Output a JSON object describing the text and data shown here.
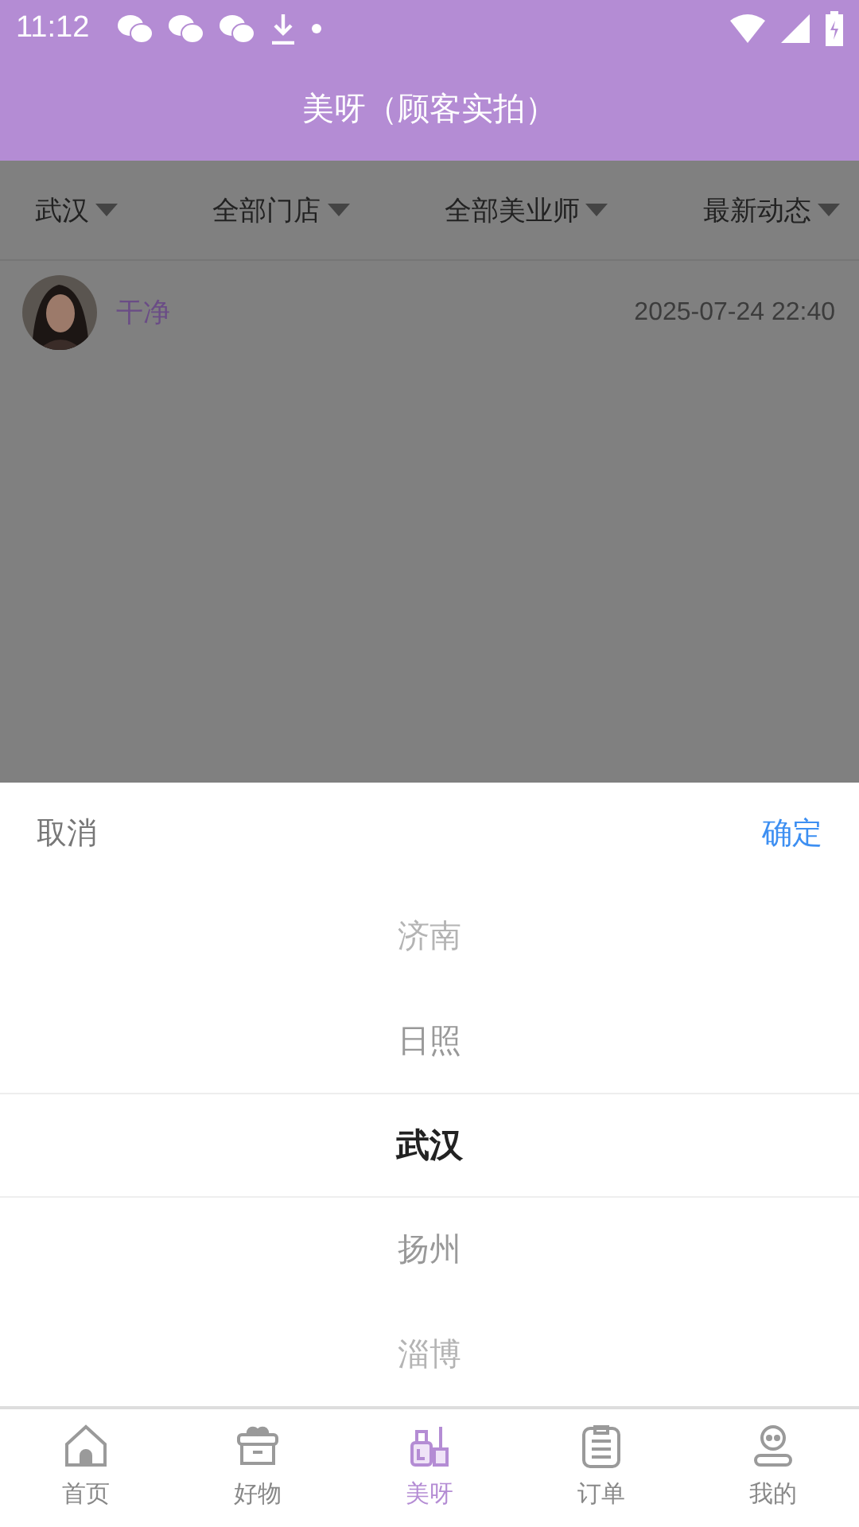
{
  "status_bar": {
    "time": "11:12"
  },
  "header": {
    "title": "美呀（顾客实拍）"
  },
  "filters": [
    {
      "label": "武汉"
    },
    {
      "label": "全部门店"
    },
    {
      "label": "全部美业师"
    },
    {
      "label": "最新动态"
    }
  ],
  "posts": [
    {
      "name": "干净",
      "time": "2025-07-24 22:40"
    }
  ],
  "picker": {
    "cancel": "取消",
    "confirm": "确定",
    "options": [
      {
        "label": "济南",
        "selected": false
      },
      {
        "label": "日照",
        "selected": false
      },
      {
        "label": "武汉",
        "selected": true
      },
      {
        "label": "扬州",
        "selected": false
      },
      {
        "label": "淄博",
        "selected": false
      }
    ]
  },
  "tab_bar": [
    {
      "label": "首页",
      "kind": "home",
      "selected": false
    },
    {
      "label": "好物",
      "kind": "goods",
      "selected": false
    },
    {
      "label": "美呀",
      "kind": "beauty",
      "selected": true
    },
    {
      "label": "订单",
      "kind": "orders",
      "selected": false
    },
    {
      "label": "我的",
      "kind": "me",
      "selected": false
    }
  ]
}
